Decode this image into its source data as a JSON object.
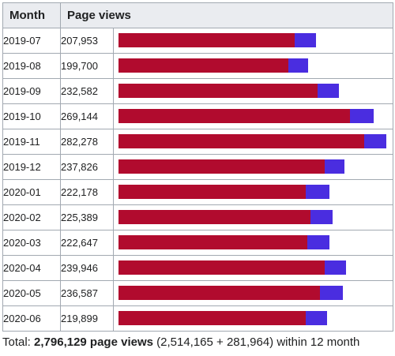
{
  "header": {
    "month": "Month",
    "views": "Page views"
  },
  "colors": {
    "desktop": "#b10b2e",
    "mobile": "#4a2de0"
  },
  "chart_data": {
    "type": "bar",
    "stacked": true,
    "orientation": "horizontal",
    "categories": [
      "2019-07",
      "2019-08",
      "2019-09",
      "2019-10",
      "2019-11",
      "2019-12",
      "2020-01",
      "2020-02",
      "2020-03",
      "2020-04",
      "2020-05",
      "2020-06"
    ],
    "totals_labels": [
      "207,953",
      "199,700",
      "232,582",
      "269,144",
      "282,278",
      "237,826",
      "222,178",
      "225,389",
      "222,647",
      "239,946",
      "236,587",
      "219,899"
    ],
    "series": [
      {
        "values": [
          185400,
          179000,
          210000,
          244000,
          259000,
          217000,
          197000,
          202000,
          199000,
          217500,
          212500,
          197000
        ]
      },
      {
        "values": [
          22553,
          20700,
          22582,
          25144,
          23278,
          20826,
          25178,
          23389,
          23647,
          22446,
          24087,
          22899
        ]
      }
    ],
    "xlim": [
      0,
      282278
    ]
  },
  "total": {
    "prefix": "Total:",
    "bold": "2,796,129 page views",
    "rest": "(2,514,165 + 281,964) within 12 month"
  }
}
